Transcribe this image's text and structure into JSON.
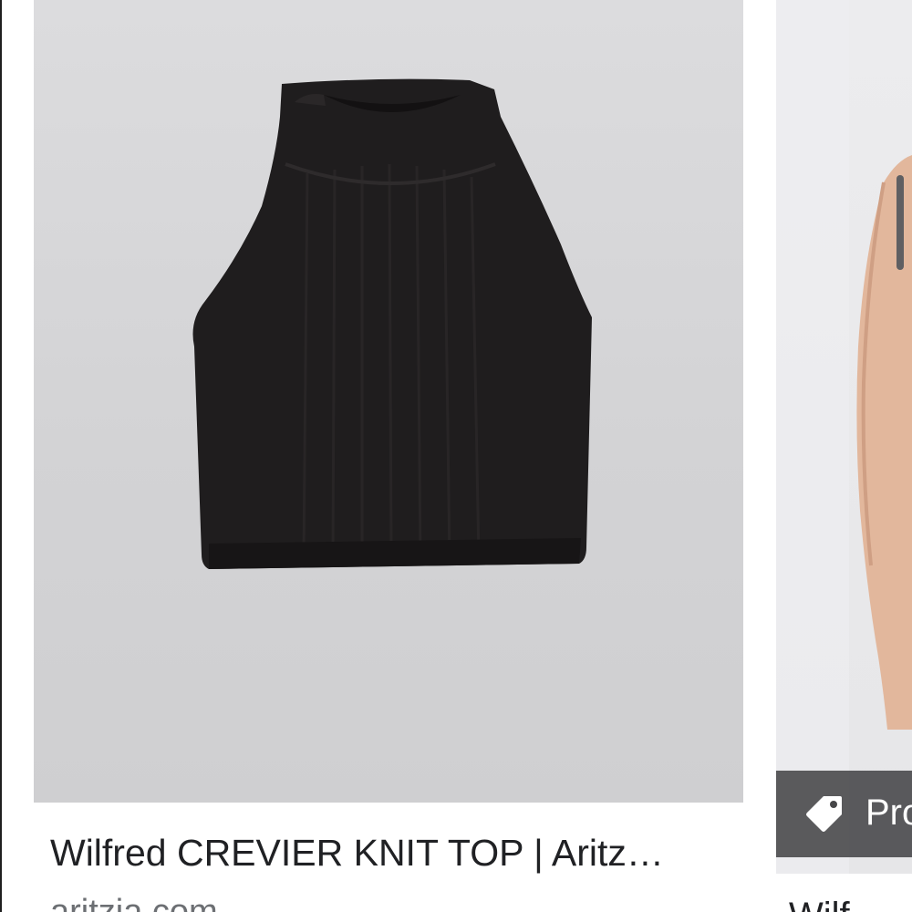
{
  "results": [
    {
      "title": "Wilfred CREVIER KNIT TOP | Aritz…",
      "source": "aritzia.com"
    },
    {
      "badge_label": "Pro",
      "badge_icon": "tag-icon",
      "title": "Wilf"
    }
  ],
  "colors": {
    "product_image_background": "#d6d6d8",
    "garment": "#1f1d1e",
    "badge_background": "#464648",
    "title_text": "#202124",
    "source_text": "#6c6f73"
  }
}
